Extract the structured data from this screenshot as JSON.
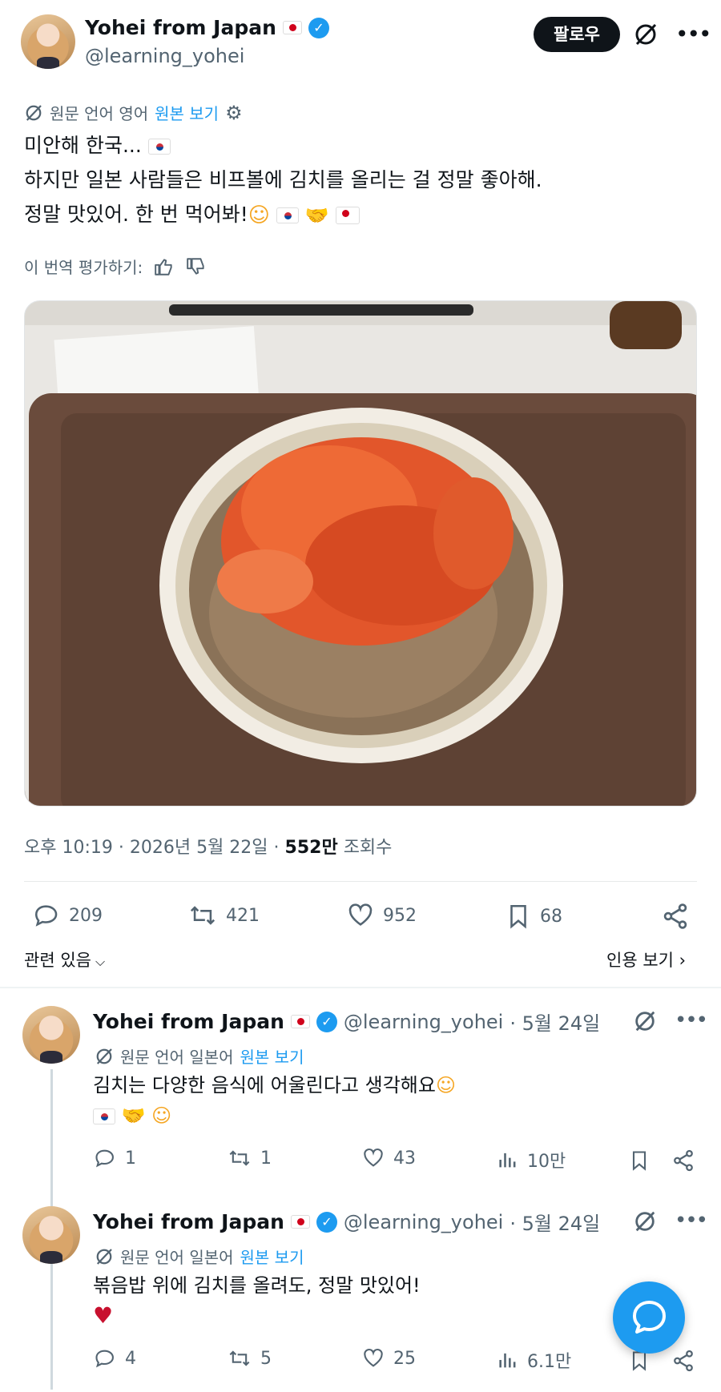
{
  "main_tweet": {
    "author_name": "Yohei from Japan",
    "handle": "@learning_yohei",
    "follow_label": "팔로우",
    "translation": {
      "source_prefix": "원문 언어 영어",
      "view_original": "원본 보기"
    },
    "lines": [
      "미안해 한국...",
      "하지만 일본 사람들은 비프볼에 김치를 올리는 걸 정말 좋아해.",
      "정말 맛있어. 한 번 먹어봐!"
    ],
    "rate_translation": "이 번역 평가하기:",
    "timestamp": "오후 10:19 · 2026년 5월 22일 · ",
    "views_count": "552만",
    "views_label": " 조회수",
    "counts": {
      "replies": "209",
      "retweets": "421",
      "likes": "952",
      "bookmarks": "68"
    },
    "related_label": "관련 있음",
    "quotes_label": "인용 보기"
  },
  "replies": [
    {
      "author_name": "Yohei from Japan",
      "handle": "@learning_yohei",
      "date": "· 5월 24일",
      "source_prefix": "원문 언어 일본어",
      "view_original": "원본 보기",
      "text": "김치는 다양한 음식에 어울린다고 생각해요",
      "counts": {
        "replies": "1",
        "retweets": "1",
        "likes": "43",
        "views": "10만"
      }
    },
    {
      "author_name": "Yohei from Japan",
      "handle": "@learning_yohei",
      "date": "· 5월 24일",
      "source_prefix": "원문 언어 일본어",
      "view_original": "원본 보기",
      "text": "볶음밥 위에 김치를 올려도, 정말 맛있어!",
      "counts": {
        "replies": "4",
        "retweets": "5",
        "likes": "25",
        "views": "6.1만"
      }
    }
  ],
  "colors": {
    "accent": "#1d9bf0",
    "text": "#0f1419",
    "secondary": "#536471"
  },
  "icons": {
    "grok": "grok-icon",
    "more": "more-icon",
    "reply": "reply-icon",
    "retweet": "retweet-icon",
    "like": "heart-icon",
    "bookmark": "bookmark-icon",
    "share": "share-icon",
    "views": "views-icon",
    "compose": "compose-reply-icon"
  }
}
